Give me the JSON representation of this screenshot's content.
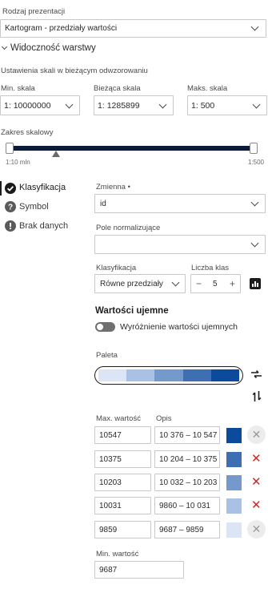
{
  "presentation": {
    "label": "Rodzaj prezentacji",
    "value": "Kartogram - przedziały wartości"
  },
  "visibility": {
    "title": "Widoczność warstwy",
    "scale_caption": "Ustawienia skali w bieżącym odwzorowaniu",
    "min_label": "Min. skala",
    "min_prefix": "1:",
    "min_value": "10000000",
    "cur_label": "Bieżąca skala",
    "cur_prefix": "1:",
    "cur_value": "1285899",
    "max_label": "Maks. skala",
    "max_prefix": "1:",
    "max_value": "500",
    "range_label": "Zakres skalowy",
    "range_min_text": "1:10 mln",
    "range_max_text": "1:500",
    "current_position": 0.19
  },
  "sidenav": [
    {
      "label": "Klasyfikacja",
      "icon": "check-circle-icon"
    },
    {
      "label": "Symbol",
      "icon": "help-circle-icon"
    },
    {
      "label": "Brak danych",
      "icon": "alert-circle-icon"
    }
  ],
  "classification": {
    "variable_label": "Zmienna •",
    "variable_value": "id",
    "normalize_label": "Pole normalizujące",
    "normalize_value": "",
    "method_label": "Klasyfikacja",
    "method_value": "Równe przedziały",
    "classes_label": "Liczba klas",
    "classes_minus": "−",
    "classes_value": "5",
    "classes_plus": "+",
    "negative_title": "Wartości ujemne",
    "negative_toggle_label": "Wyróżnienie wartości ujemnych",
    "palette_label": "Paleta",
    "palette_colors": [
      "#dbe5f6",
      "#a9c1e4",
      "#7499cd",
      "#3f6fb3",
      "#0c4a9c"
    ],
    "max_header": "Max. wartość",
    "desc_header": "Opis",
    "rows": [
      {
        "max": "10547",
        "desc": "10 376 – 10 547",
        "color": "#0c4a9c",
        "remove_enabled": false
      },
      {
        "max": "10375",
        "desc": "10 204 – 10 375",
        "color": "#3f6fb3",
        "remove_enabled": true
      },
      {
        "max": "10203",
        "desc": "10 032 – 10 203",
        "color": "#7499cd",
        "remove_enabled": true
      },
      {
        "max": "10031",
        "desc": "9860 – 10 031",
        "color": "#a9c1e4",
        "remove_enabled": true
      },
      {
        "max": "9859",
        "desc": "9687 – 9859",
        "color": "#dbe5f6",
        "remove_enabled": false
      }
    ],
    "min_label": "Min. wartość",
    "min_value": "9687"
  }
}
